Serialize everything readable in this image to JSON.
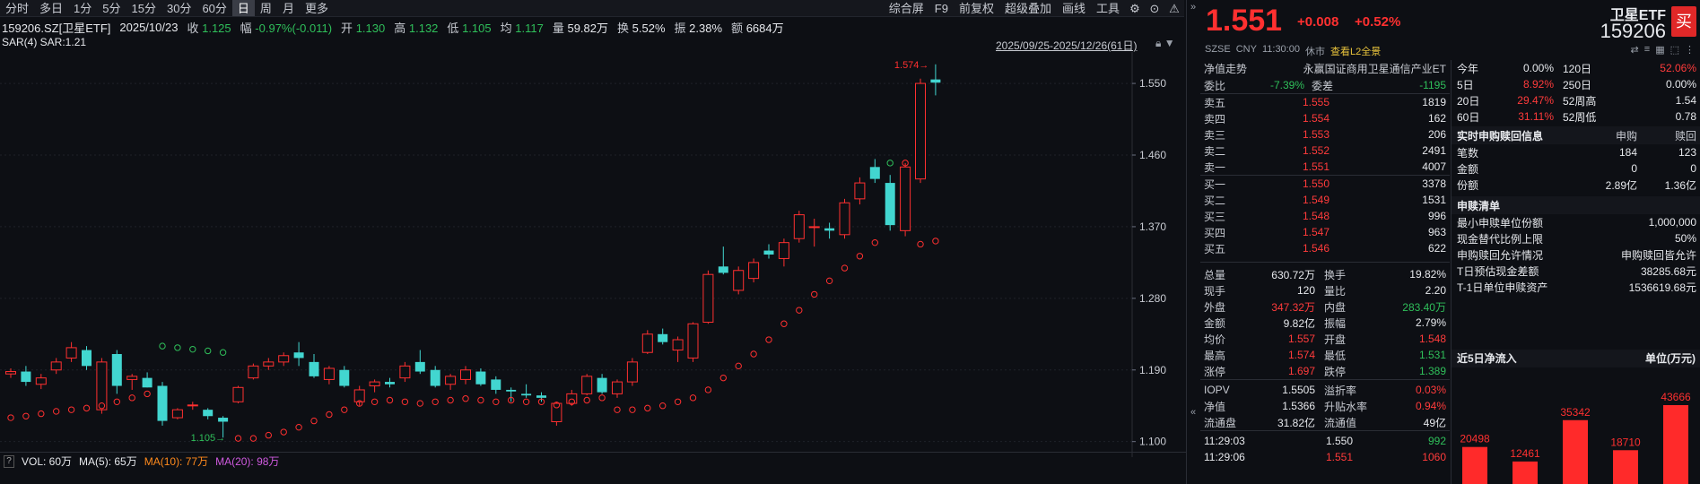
{
  "toolbar": {
    "periods": [
      "分时",
      "多日",
      "1分",
      "5分",
      "15分",
      "30分",
      "60分",
      "日",
      "周",
      "月",
      "更多"
    ],
    "active_index": 7,
    "right_items": [
      "综合屏",
      "F9",
      "前复权",
      "超级叠加",
      "画线",
      "工具"
    ]
  },
  "info": {
    "code_name": "159206.SZ[卫星ETF]",
    "date": "2025/10/23",
    "close_label": "收",
    "close": "1.125",
    "amp_label": "幅",
    "amp": "-0.97%(-0.011)",
    "open_label": "开",
    "open": "1.130",
    "high_label": "高",
    "high": "1.132",
    "low_label": "低",
    "low": "1.105",
    "avg_label": "均",
    "avg": "1.117",
    "vol_label": "量",
    "vol": "59.82万",
    "turn_label": "换",
    "turn": "5.52%",
    "swing_label": "振",
    "swing": "2.38%",
    "amount_label": "额",
    "amount": "6684万",
    "sar_line": "SAR(4)  SAR:1.21",
    "range": "2025/09/25-2025/12/26(61日)"
  },
  "chart_data": {
    "type": "candlestick",
    "y_ticks": [
      1.1,
      1.19,
      1.28,
      1.37,
      1.46,
      1.55
    ],
    "ylim": [
      1.085,
      1.585
    ],
    "annotations": {
      "high_label": "1.574",
      "low_label": "1.105"
    },
    "candles": [
      {
        "o": 1.185,
        "h": 1.192,
        "l": 1.18,
        "c": 1.188,
        "sar": 1.13
      },
      {
        "o": 1.188,
        "h": 1.195,
        "l": 1.17,
        "c": 1.175,
        "sar": 1.132
      },
      {
        "o": 1.172,
        "h": 1.185,
        "l": 1.166,
        "c": 1.18,
        "sar": 1.135
      },
      {
        "o": 1.19,
        "h": 1.205,
        "l": 1.185,
        "c": 1.2,
        "sar": 1.138
      },
      {
        "o": 1.205,
        "h": 1.225,
        "l": 1.2,
        "c": 1.218,
        "sar": 1.14
      },
      {
        "o": 1.215,
        "h": 1.22,
        "l": 1.19,
        "c": 1.195,
        "sar": 1.142
      },
      {
        "o": 1.14,
        "h": 1.205,
        "l": 1.135,
        "c": 1.2,
        "sar": 1.145
      },
      {
        "o": 1.21,
        "h": 1.215,
        "l": 1.16,
        "c": 1.17,
        "sar": 1.15
      },
      {
        "o": 1.178,
        "h": 1.185,
        "l": 1.165,
        "c": 1.182,
        "sar": 1.155
      },
      {
        "o": 1.18,
        "h": 1.187,
        "l": 1.168,
        "c": 1.168,
        "sar": 1.16
      },
      {
        "o": 1.17,
        "h": 1.175,
        "l": 1.12,
        "c": 1.126,
        "sar": 1.22
      },
      {
        "o": 1.13,
        "h": 1.142,
        "l": 1.128,
        "c": 1.14,
        "sar": 1.218
      },
      {
        "o": 1.145,
        "h": 1.15,
        "l": 1.14,
        "c": 1.146,
        "sar": 1.216
      },
      {
        "o": 1.14,
        "h": 1.142,
        "l": 1.128,
        "c": 1.132,
        "sar": 1.214
      },
      {
        "o": 1.13,
        "h": 1.132,
        "l": 1.105,
        "c": 1.125,
        "sar": 1.212
      },
      {
        "o": 1.15,
        "h": 1.17,
        "l": 1.148,
        "c": 1.168,
        "sar": 1.104
      },
      {
        "o": 1.18,
        "h": 1.198,
        "l": 1.178,
        "c": 1.195,
        "sar": 1.104
      },
      {
        "o": 1.195,
        "h": 1.205,
        "l": 1.19,
        "c": 1.2,
        "sar": 1.108
      },
      {
        "o": 1.2,
        "h": 1.212,
        "l": 1.195,
        "c": 1.208,
        "sar": 1.112
      },
      {
        "o": 1.212,
        "h": 1.225,
        "l": 1.195,
        "c": 1.205,
        "sar": 1.118
      },
      {
        "o": 1.2,
        "h": 1.21,
        "l": 1.18,
        "c": 1.182,
        "sar": 1.126
      },
      {
        "o": 1.178,
        "h": 1.195,
        "l": 1.172,
        "c": 1.192,
        "sar": 1.134
      },
      {
        "o": 1.19,
        "h": 1.195,
        "l": 1.168,
        "c": 1.17,
        "sar": 1.14
      },
      {
        "o": 1.15,
        "h": 1.17,
        "l": 1.145,
        "c": 1.165,
        "sar": 1.148
      },
      {
        "o": 1.17,
        "h": 1.178,
        "l": 1.162,
        "c": 1.175,
        "sar": 1.15
      },
      {
        "o": 1.175,
        "h": 1.18,
        "l": 1.168,
        "c": 1.172,
        "sar": 1.152
      },
      {
        "o": 1.18,
        "h": 1.2,
        "l": 1.175,
        "c": 1.195,
        "sar": 1.15
      },
      {
        "o": 1.2,
        "h": 1.215,
        "l": 1.185,
        "c": 1.188,
        "sar": 1.148
      },
      {
        "o": 1.19,
        "h": 1.195,
        "l": 1.168,
        "c": 1.17,
        "sar": 1.15
      },
      {
        "o": 1.172,
        "h": 1.185,
        "l": 1.165,
        "c": 1.182,
        "sar": 1.152
      },
      {
        "o": 1.178,
        "h": 1.195,
        "l": 1.172,
        "c": 1.19,
        "sar": 1.154
      },
      {
        "o": 1.188,
        "h": 1.192,
        "l": 1.17,
        "c": 1.172,
        "sar": 1.152
      },
      {
        "o": 1.178,
        "h": 1.182,
        "l": 1.16,
        "c": 1.165,
        "sar": 1.15
      },
      {
        "o": 1.165,
        "h": 1.168,
        "l": 1.15,
        "c": 1.163,
        "sar": 1.152
      },
      {
        "o": 1.16,
        "h": 1.172,
        "l": 1.155,
        "c": 1.158,
        "sar": 1.15
      },
      {
        "o": 1.158,
        "h": 1.162,
        "l": 1.15,
        "c": 1.155,
        "sar": 1.15
      },
      {
        "o": 1.125,
        "h": 1.15,
        "l": 1.12,
        "c": 1.148,
        "sar": 1.146
      },
      {
        "o": 1.148,
        "h": 1.165,
        "l": 1.145,
        "c": 1.16,
        "sar": 1.15
      },
      {
        "o": 1.16,
        "h": 1.185,
        "l": 1.158,
        "c": 1.182,
        "sar": 1.152
      },
      {
        "o": 1.18,
        "h": 1.185,
        "l": 1.16,
        "c": 1.162,
        "sar": 1.155
      },
      {
        "o": 1.16,
        "h": 1.178,
        "l": 1.155,
        "c": 1.175,
        "sar": 1.14
      },
      {
        "o": 1.175,
        "h": 1.205,
        "l": 1.17,
        "c": 1.2,
        "sar": 1.14
      },
      {
        "o": 1.212,
        "h": 1.24,
        "l": 1.21,
        "c": 1.235,
        "sar": 1.142
      },
      {
        "o": 1.235,
        "h": 1.242,
        "l": 1.222,
        "c": 1.225,
        "sar": 1.145
      },
      {
        "o": 1.215,
        "h": 1.232,
        "l": 1.2,
        "c": 1.228,
        "sar": 1.15
      },
      {
        "o": 1.205,
        "h": 1.25,
        "l": 1.2,
        "c": 1.248,
        "sar": 1.155
      },
      {
        "o": 1.25,
        "h": 1.315,
        "l": 1.248,
        "c": 1.31,
        "sar": 1.165
      },
      {
        "o": 1.32,
        "h": 1.345,
        "l": 1.31,
        "c": 1.312,
        "sar": 1.18
      },
      {
        "o": 1.29,
        "h": 1.32,
        "l": 1.285,
        "c": 1.315,
        "sar": 1.195
      },
      {
        "o": 1.305,
        "h": 1.33,
        "l": 1.3,
        "c": 1.325,
        "sar": 1.21
      },
      {
        "o": 1.34,
        "h": 1.348,
        "l": 1.33,
        "c": 1.335,
        "sar": 1.228
      },
      {
        "o": 1.33,
        "h": 1.355,
        "l": 1.32,
        "c": 1.35,
        "sar": 1.248
      },
      {
        "o": 1.355,
        "h": 1.39,
        "l": 1.35,
        "c": 1.385,
        "sar": 1.265
      },
      {
        "o": 1.37,
        "h": 1.38,
        "l": 1.345,
        "c": 1.37,
        "sar": 1.285
      },
      {
        "o": 1.368,
        "h": 1.375,
        "l": 1.355,
        "c": 1.365,
        "sar": 1.302
      },
      {
        "o": 1.36,
        "h": 1.405,
        "l": 1.355,
        "c": 1.4,
        "sar": 1.318
      },
      {
        "o": 1.405,
        "h": 1.432,
        "l": 1.398,
        "c": 1.425,
        "sar": 1.333
      },
      {
        "o": 1.445,
        "h": 1.455,
        "l": 1.425,
        "c": 1.43,
        "sar": 1.35
      },
      {
        "o": 1.425,
        "h": 1.435,
        "l": 1.365,
        "c": 1.372,
        "sar": 1.45
      },
      {
        "o": 1.365,
        "h": 1.45,
        "l": 1.358,
        "c": 1.445,
        "sar": 1.45
      },
      {
        "o": 1.43,
        "h": 1.556,
        "l": 1.425,
        "c": 1.55,
        "sar": 1.348
      },
      {
        "o": 1.555,
        "h": 1.574,
        "l": 1.535,
        "c": 1.551,
        "sar": 1.352
      }
    ]
  },
  "volume_line": {
    "vol_label": "VOL: 60万",
    "ma5": "MA(5): 65万",
    "ma10": "MA(10): 77万",
    "ma20": "MA(20): 98万"
  },
  "quote": {
    "price": "1.551",
    "change": "+0.008",
    "pct": "+0.52%",
    "name": "卫星ETF",
    "code": "159206",
    "buy": "买",
    "meta": {
      "exch": "SZSE",
      "ccy": "CNY",
      "time": "11:30:00",
      "status": "休市",
      "l2": "查看L2全景"
    },
    "nav_trend": "净值走势",
    "fund_name": "永赢国证商用卫星通信产业ET",
    "wb_label": "委比",
    "wb": "-7.39%",
    "wc_label": "委差",
    "wc": "-1195",
    "asks": [
      {
        "label": "卖五",
        "price": "1.555",
        "vol": "1819"
      },
      {
        "label": "卖四",
        "price": "1.554",
        "vol": "162"
      },
      {
        "label": "卖三",
        "price": "1.553",
        "vol": "206"
      },
      {
        "label": "卖二",
        "price": "1.552",
        "vol": "2491"
      },
      {
        "label": "卖一",
        "price": "1.551",
        "vol": "4007"
      }
    ],
    "bids": [
      {
        "label": "买一",
        "price": "1.550",
        "vol": "3378"
      },
      {
        "label": "买二",
        "price": "1.549",
        "vol": "1531"
      },
      {
        "label": "买三",
        "price": "1.548",
        "vol": "996"
      },
      {
        "label": "买四",
        "price": "1.547",
        "vol": "963"
      },
      {
        "label": "买五",
        "price": "1.546",
        "vol": "622"
      }
    ],
    "stats": [
      {
        "l1": "总量",
        "v1": "630.72万",
        "c1": "w",
        "l2": "换手",
        "v2": "19.82%",
        "c2": "w"
      },
      {
        "l1": "现手",
        "v1": "120",
        "c1": "w",
        "l2": "量比",
        "v2": "2.20",
        "c2": "w"
      },
      {
        "l1": "外盘",
        "v1": "347.32万",
        "c1": "r",
        "l2": "内盘",
        "v2": "283.40万",
        "c2": "g"
      },
      {
        "l1": "金额",
        "v1": "9.82亿",
        "c1": "w",
        "l2": "振幅",
        "v2": "2.79%",
        "c2": "w"
      },
      {
        "l1": "均价",
        "v1": "1.557",
        "c1": "r",
        "l2": "开盘",
        "v2": "1.548",
        "c2": "r"
      },
      {
        "l1": "最高",
        "v1": "1.574",
        "c1": "r",
        "l2": "最低",
        "v2": "1.531",
        "c2": "g"
      },
      {
        "l1": "涨停",
        "v1": "1.697",
        "c1": "r",
        "l2": "跌停",
        "v2": "1.389",
        "c2": "g"
      }
    ],
    "stats2": [
      {
        "l1": "IOPV",
        "v1": "1.5505",
        "c1": "w",
        "l2": "溢折率",
        "v2": "0.03%",
        "c2": "r"
      },
      {
        "l1": "净值",
        "v1": "1.5366",
        "c1": "w",
        "l2": "升贴水率",
        "v2": "0.94%",
        "c2": "r"
      },
      {
        "l1": "流通盘",
        "v1": "31.82亿",
        "c1": "w",
        "l2": "流通值",
        "v2": "49亿",
        "c2": "w"
      }
    ],
    "ticks": [
      {
        "time": "11:29:03",
        "price": "1.550",
        "vol": "992",
        "pc": "w",
        "vc": "g"
      },
      {
        "time": "11:29:06",
        "price": "1.551",
        "vol": "1060",
        "pc": "r",
        "vc": "r"
      }
    ],
    "periods": [
      {
        "l": "今年",
        "v": "0.00%",
        "vc": "w",
        "l2": "120日",
        "v2": "52.06%",
        "v2c": "r"
      },
      {
        "l": "5日",
        "v": "8.92%",
        "vc": "r",
        "l2": "250日",
        "v2": "0.00%",
        "v2c": "w"
      },
      {
        "l": "20日",
        "v": "29.47%",
        "vc": "r",
        "l2": "52周高",
        "v2": "1.54",
        "v2c": "w"
      },
      {
        "l": "60日",
        "v": "31.11%",
        "vc": "r",
        "l2": "52周低",
        "v2": "0.78",
        "v2c": "w"
      }
    ],
    "subscribe": {
      "title": "实时申购赎回信息",
      "col1": "申购",
      "col2": "赎回",
      "rows": [
        {
          "k": "笔数",
          "a": "184",
          "b": "123"
        },
        {
          "k": "金额",
          "a": "0",
          "b": "0"
        },
        {
          "k": "份额",
          "a": "2.89亿",
          "b": "1.36亿"
        }
      ]
    },
    "list": {
      "title": "申赎清单",
      "rows": [
        {
          "k": "最小申赎单位份额",
          "v": "1,000,000"
        },
        {
          "k": "现金替代比例上限",
          "v": "50%"
        },
        {
          "k": "申购赎回允许情况",
          "v": "申购赎回皆允许"
        },
        {
          "k": "T日预估现金差额",
          "v": "38285.68元"
        },
        {
          "k": "T-1日单位申赎资产",
          "v": "1536619.68元"
        }
      ]
    },
    "flow": {
      "title": "近5日净流入",
      "unit": "单位(万元)",
      "values": [
        20498,
        12461,
        35342,
        18710,
        43666
      ]
    }
  }
}
